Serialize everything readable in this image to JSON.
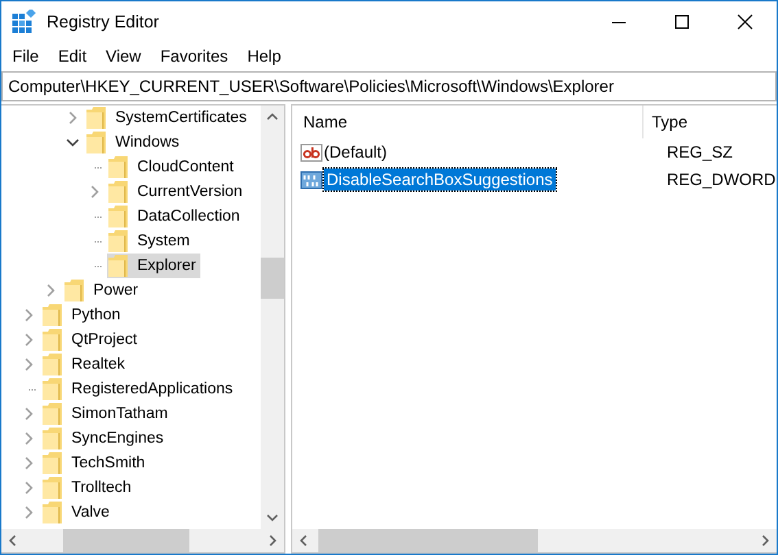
{
  "window": {
    "title": "Registry Editor"
  },
  "menu": [
    "File",
    "Edit",
    "View",
    "Favorites",
    "Help"
  ],
  "address_bar": {
    "value": "Computer\\HKEY_CURRENT_USER\\Software\\Policies\\Microsoft\\Windows\\Explorer"
  },
  "tree": {
    "items": [
      {
        "children": [
          {
            "children": [
              {
                "label": "SystemCertificates",
                "expandable": true,
                "expanded": false,
                "selected": false
              },
              {
                "label": "Windows",
                "expandable": true,
                "expanded": true,
                "selected": false,
                "children": [
                  {
                    "label": "CloudContent",
                    "expandable": false,
                    "expanded": false,
                    "selected": false
                  },
                  {
                    "label": "CurrentVersion",
                    "expandable": true,
                    "expanded": false,
                    "selected": false
                  },
                  {
                    "label": "DataCollection",
                    "expandable": false,
                    "expanded": false,
                    "selected": false
                  },
                  {
                    "label": "System",
                    "expandable": false,
                    "expanded": false,
                    "selected": false
                  },
                  {
                    "label": "Explorer",
                    "expandable": false,
                    "expanded": false,
                    "selected": true
                  }
                ]
              }
            ]
          },
          {
            "label": "Power",
            "expandable": true,
            "expanded": false,
            "selected": false
          }
        ]
      },
      {
        "label": "Python",
        "expandable": true,
        "expanded": false,
        "selected": false
      },
      {
        "label": "QtProject",
        "expandable": true,
        "expanded": false,
        "selected": false
      },
      {
        "label": "Realtek",
        "expandable": true,
        "expanded": false,
        "selected": false
      },
      {
        "label": "RegisteredApplications",
        "expandable": false,
        "expanded": false,
        "selected": false
      },
      {
        "label": "SimonTatham",
        "expandable": true,
        "expanded": false,
        "selected": false
      },
      {
        "label": "SyncEngines",
        "expandable": true,
        "expanded": false,
        "selected": false
      },
      {
        "label": "TechSmith",
        "expandable": true,
        "expanded": false,
        "selected": false
      },
      {
        "label": "Trolltech",
        "expandable": true,
        "expanded": false,
        "selected": false
      },
      {
        "label": "Valve",
        "expandable": true,
        "expanded": false,
        "selected": false
      }
    ]
  },
  "values": {
    "columns": [
      "Name",
      "Type"
    ],
    "rows": [
      {
        "kind": "string",
        "name": "(Default)",
        "type": "REG_SZ",
        "selected": false
      },
      {
        "kind": "dword",
        "name": "DisableSearchBoxSuggestions",
        "type": "REG_DWORD",
        "selected": true
      }
    ]
  }
}
